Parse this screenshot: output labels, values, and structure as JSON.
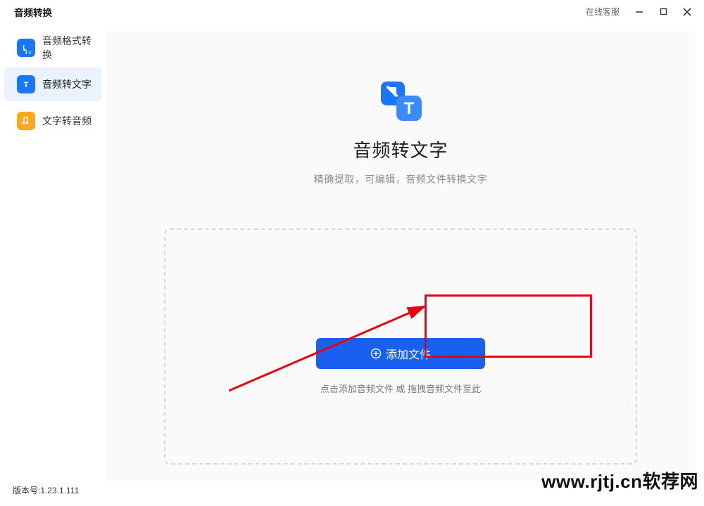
{
  "app": {
    "title": "音频转换"
  },
  "titlebar": {
    "online_service": "在线客服"
  },
  "sidebar": {
    "items": [
      {
        "label": "音频格式转换"
      },
      {
        "label": "音频转文字"
      },
      {
        "label": "文字转音频"
      }
    ]
  },
  "hero": {
    "title": "音频转文字",
    "subtitle": "精确提取，可编辑，音频文件转换文字"
  },
  "dropzone": {
    "add_label": "添加文件",
    "hint": "点击添加音频文件 或 拖拽音频文件至此"
  },
  "footer": {
    "version": "版本号:1.23.1.111"
  },
  "watermark": "www.rjtj.cn软荐网",
  "colors": {
    "primary": "#1960f1",
    "orange": "#ffa61a",
    "highlight": "#e60012"
  }
}
